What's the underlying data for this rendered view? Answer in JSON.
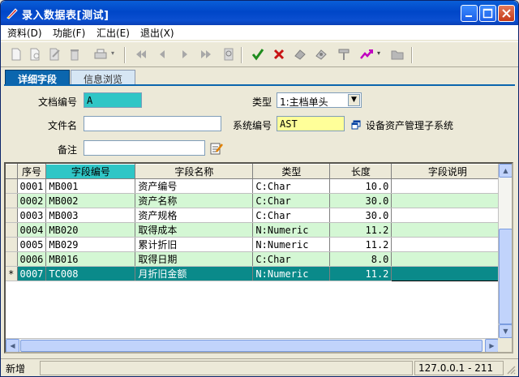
{
  "window": {
    "title": "录入数据表[测试]"
  },
  "menu": [
    {
      "label": "资料(D)"
    },
    {
      "label": "功能(F)"
    },
    {
      "label": "汇出(E)"
    },
    {
      "label": "退出(X)"
    }
  ],
  "tabs": [
    {
      "label": "详细字段",
      "active": true
    },
    {
      "label": "信息浏览",
      "active": false
    }
  ],
  "form": {
    "doc_no_label": "文档编号",
    "doc_no_value": "A",
    "type_label": "类型",
    "type_value": "1:主档单头",
    "filename_label": "文件名",
    "filename_value": "",
    "sysno_label": "系统编号",
    "sysno_value": "AST",
    "sysname": "设备资产管理子系统",
    "remark_label": "备注",
    "remark_value": ""
  },
  "grid": {
    "columns": [
      "序号",
      "字段编号",
      "字段名称",
      "类型",
      "长度",
      "字段说明"
    ],
    "rows": [
      {
        "seq": "0001",
        "code": "MB001",
        "name": "资产编号",
        "type": "C:Char",
        "length": "10.0",
        "desc": ""
      },
      {
        "seq": "0002",
        "code": "MB002",
        "name": "资产名称",
        "type": "C:Char",
        "length": "30.0",
        "desc": ""
      },
      {
        "seq": "0003",
        "code": "MB003",
        "name": "资产规格",
        "type": "C:Char",
        "length": "30.0",
        "desc": ""
      },
      {
        "seq": "0004",
        "code": "MB020",
        "name": "取得成本",
        "type": "N:Numeric",
        "length": "11.2",
        "desc": ""
      },
      {
        "seq": "0005",
        "code": "MB029",
        "name": "累计折旧",
        "type": "N:Numeric",
        "length": "11.2",
        "desc": ""
      },
      {
        "seq": "0006",
        "code": "MB016",
        "name": "取得日期",
        "type": "C:Char",
        "length": "8.0",
        "desc": ""
      },
      {
        "seq": "0007",
        "code": "TC008",
        "name": "月折旧金额",
        "type": "N:Numeric",
        "length": "11.2",
        "desc": "",
        "marker": "*"
      }
    ]
  },
  "status": {
    "mode": "新增",
    "ip": "127.0.0.1 - 211"
  },
  "colors": {
    "title_bar": "#0046c8",
    "tab_active": "#0b66ae",
    "highlight_teal": "#2fc6c6",
    "row_green": "#d4f7d4",
    "row_selected": "#0a8a8a",
    "yellow_input": "#ffff99"
  }
}
